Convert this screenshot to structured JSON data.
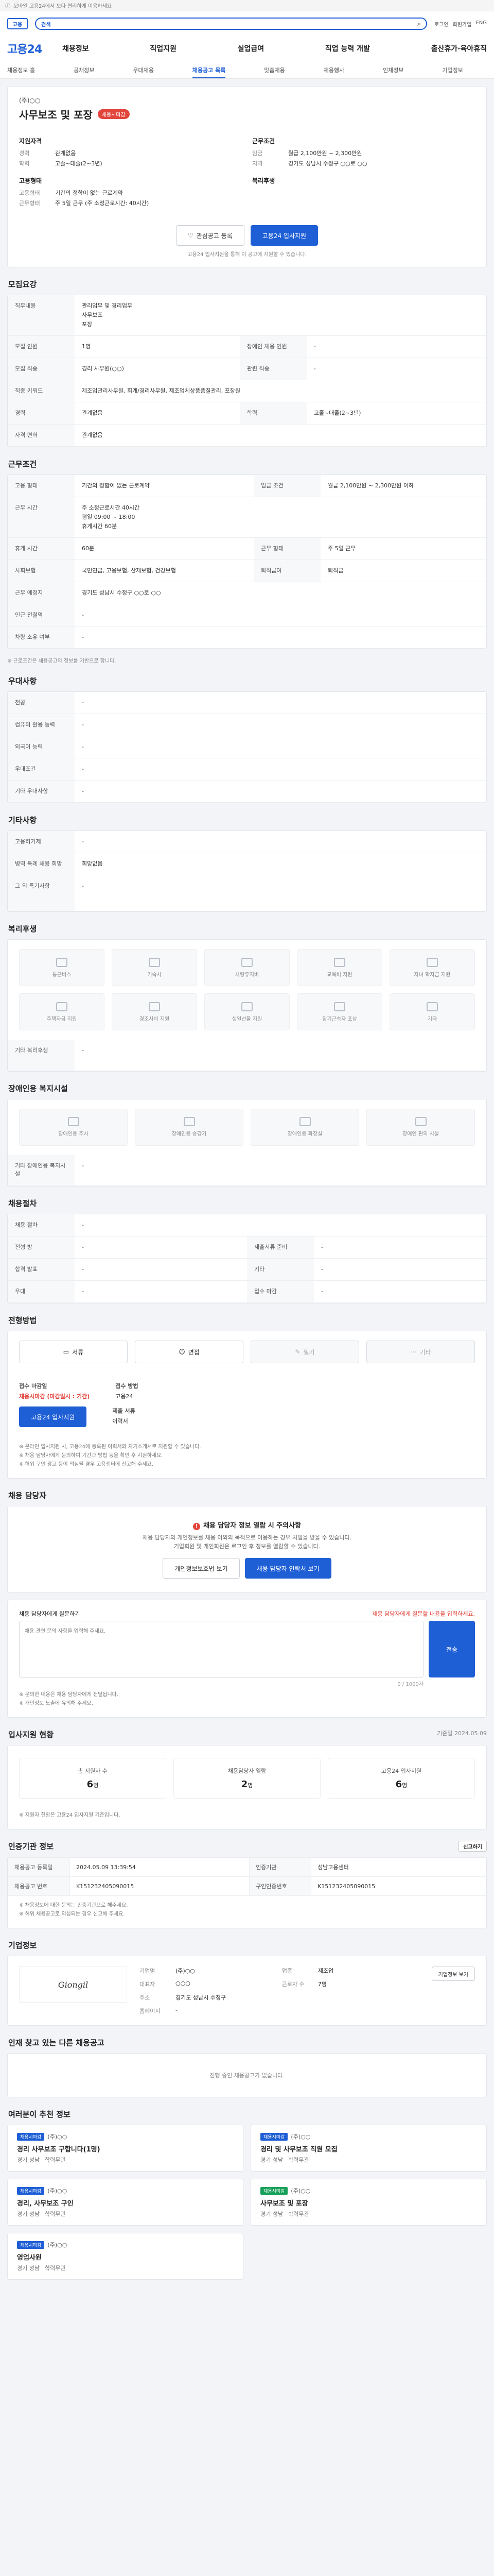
{
  "topbar": {
    "text": "모바일 고용24에서 보다 편리하게 이용하세요"
  },
  "header": {
    "mark": "고용",
    "search_tag": "검색",
    "search_placeholder": "",
    "links": [
      "로그인",
      "회원가입",
      "ENG"
    ],
    "logo": "고용24",
    "gnb": [
      "채용정보",
      "직업지원",
      "실업급여",
      "직업 능력 개발",
      "출산휴가·육아휴직"
    ],
    "subnav": [
      "채용정보 홈",
      "공채정보",
      "우대채용",
      "채용공고 목록",
      "맞춤채용",
      "채용행사",
      "인재정보",
      "기업정보"
    ],
    "subnav_active": "채용공고 목록"
  },
  "summary": {
    "company": "(주)○○",
    "title": "사무보조 및 포장",
    "deadline": "채용시마감",
    "left_heading": "지원자격",
    "left_rows": [
      {
        "k": "경력",
        "v": "관계없음"
      },
      {
        "k": "학력",
        "v": "고졸~대졸(2~3년)"
      }
    ],
    "left_heading2": "고용형태",
    "left_rows2": [
      {
        "k": "고용형태",
        "v": "기간의 정함이 없는 근로계약"
      },
      {
        "k": "근무형태",
        "v": "주 5일 근무 (주 소정근로시간: 40시간)"
      }
    ],
    "right_heading": "근무조건",
    "right_rows": [
      {
        "k": "임금",
        "v": "월급 2,100만원 ~ 2,300만원"
      },
      {
        "k": "지역",
        "v": "경기도 성남시 수정구 ○○로 ○○"
      }
    ],
    "right_heading2": "복리후생",
    "btn_scrap": "관심공고 등록",
    "btn_apply": "고용24 입사지원",
    "note": "고용24 입사지원을 통해 이 공고에 지원할 수 있습니다."
  },
  "sections": {
    "recruit": "모집요강",
    "conditions": "근무조건",
    "pref": "우대사항",
    "etc": "기타사항",
    "welfare": "복리후생",
    "disabled": "장애인용 복지시설",
    "process": "채용절차",
    "method": "전형방법",
    "manager": "채용 담당자",
    "stats": "입사지원 현황",
    "stats_sub": "기준일",
    "info": "인증기관 정보",
    "company": "기업정보",
    "other": "인재 찾고 있는 다른 채용공고",
    "rec": "여러분이 추천 정보"
  },
  "recruit_table": [
    {
      "k": "직무내용",
      "v": "관리업무 및 경리업무\n사무보조\n포장"
    },
    {
      "k": "모집 인원",
      "v": "1명",
      "k2": "장애인 채용 인원",
      "v2": "-"
    },
    {
      "k": "모집 직종",
      "v": "경리 사무원(○○)",
      "k2": "관련 직종",
      "v2": "-"
    },
    {
      "k": "직종 키워드",
      "v": "제조업관리사무원, 회계/경리사무원, 제조업체상품품질관리, 포장원"
    },
    {
      "k": "경력",
      "v": "관계없음",
      "k2": "학력",
      "v2": "고졸~대졸(2~3년)"
    },
    {
      "k": "자격 면허",
      "v": "관계없음"
    }
  ],
  "cond_table": [
    {
      "k": "고용 형태",
      "v": "기간의 정함이 없는 근로계약",
      "k2": "임금 조건",
      "v2": "월급 2,100만원 ~ 2,300만원 이하"
    },
    {
      "k": "근무 시간",
      "v": "주 소정근로시간 40시간\n평일 09:00 ~ 18:00\n휴게시간 60분"
    },
    {
      "k": "휴게 시간",
      "v": "60분",
      "k2": "근무 형태",
      "v2": "주 5일 근무"
    },
    {
      "k": "사회보험",
      "v": "국민연금, 고용보험, 산재보험, 건강보험",
      "k2": "퇴직급여",
      "v2": "퇴직금"
    },
    {
      "k": "근무 예정지",
      "v": "경기도 성남시 수정구 ○○로 ○○"
    },
    {
      "k": "인근 전철역",
      "v": "-"
    },
    {
      "k": "차량 소유 여부",
      "v": "-"
    }
  ],
  "cond_note": "※ 근로조건은 채용공고의 정보를 기반으로 합니다.",
  "pref_table": [
    {
      "k": "전공",
      "v": "-"
    },
    {
      "k": "컴퓨터 활용 능력",
      "v": "-"
    },
    {
      "k": "외국어 능력",
      "v": "-"
    },
    {
      "k": "우대조건",
      "v": "-"
    },
    {
      "k": "기타 우대사항",
      "v": "-"
    }
  ],
  "etc_table": [
    {
      "k": "고용허가제",
      "v": "-"
    },
    {
      "k": "병역 특례 채용 희망",
      "v": "희망없음"
    },
    {
      "k": "그 외 특기사항",
      "v": "-"
    }
  ],
  "welfare_items": [
    "통근버스",
    "기숙사",
    "차량유지비",
    "교육비 지원",
    "자녀 학자금 지원",
    "주택자금 지원",
    "경조사비 지원",
    "생일선물 지원",
    "장기근속자 포상",
    "기타"
  ],
  "welfare_etc_label": "기타 복리후생",
  "welfare_etc_value": "-",
  "disabled_items": [
    "장애인용 주차",
    "장애인용 승강기",
    "장애인용 화장실",
    "장애인 편의 시설"
  ],
  "disabled_etc_label": "기타 장애인용 복지시설",
  "disabled_etc_value": "-",
  "process_table": [
    {
      "k": "채용 절차",
      "v": "-"
    },
    {
      "k": "전형 방",
      "v": "-",
      "k2": "제출서류 준비",
      "v2": "-"
    },
    {
      "k": "합격 발표",
      "v": "-",
      "k2": "기타",
      "v2": "-"
    },
    {
      "k": "우대",
      "v": "-",
      "k2": "접수 마감",
      "v2": "-"
    }
  ],
  "methods": [
    {
      "label": "서류",
      "on": true
    },
    {
      "label": "면접",
      "on": true
    },
    {
      "label": "필기",
      "on": false
    },
    {
      "label": "기타",
      "on": false
    }
  ],
  "apply": {
    "deadline_lbl": "접수 마감일",
    "deadline_val": "채용시마감 (마감일시 : 기간)",
    "method_lbl": "접수 방법",
    "method_val": "고용24",
    "button": "고용24 입사지원",
    "docs_lbl": "제출 서류",
    "docs_val": "이력서"
  },
  "apply_notes": [
    "※ 온라인 입사지원 시, 고용24에 등록된 이력서와 자기소개서로 지원할 수 있습니다.",
    "※ 채용 담당자에게 문의하여 기간과 방법 등을 확인 후 지원하세요.",
    "※ 허위 구인 광고 등이 의심될 경우 고용센터에 신고해 주세요."
  ],
  "manager": {
    "alert": "채용 담당자 정보 열람 시 주의사항",
    "line1": "채용 담당자의 개인정보를 채용 이외의 목적으로 이용하는 경우 처벌을 받을 수 있습니다.",
    "line2": "기업회원 및 개인회원은 로그인 후 정보를 열람할 수 있습니다.",
    "btn1": "개인정보보호법 보기",
    "btn2": "채용 담당자 연락처 보기"
  },
  "qa": {
    "title": "채용 담당자에게 질문하기",
    "guide": "채용 담당자에게 질문할 내용을 입력하세요.",
    "placeholder": "채용 관련 문의 사항을 입력해 주세요.",
    "count": "0 / 1000자",
    "send": "전송",
    "notes": [
      "※ 문의한 내용은 채용 담당자에게 전달됩니다.",
      "※ 개인정보 노출에 유의해 주세요."
    ]
  },
  "stats": [
    {
      "t": "총 지원자 수",
      "n": "6",
      "u": "명"
    },
    {
      "t": "채용담당자 열람",
      "n": "2",
      "u": "명"
    },
    {
      "t": "고용24 입사지원",
      "n": "6",
      "u": "명"
    }
  ],
  "stats_note": "※ 지원자 현황은 고용24 입사지원 기준입니다.",
  "stats_date": "기준일 2024.05.09",
  "info_table": [
    {
      "k": "채용공고 등록일",
      "v": "2024.05.09 13:39:54",
      "k2": "인증기관",
      "v2": "성남고용센터"
    },
    {
      "k": "채용공고 번호",
      "v": "K151232405090015",
      "k2": "구인인증번호",
      "v2": "K151232405090015"
    }
  ],
  "info_notes": [
    "※ 채용정보에 대한 문의는 인증기관으로 해주세요.",
    "※ 허위 채용공고로 의심되는 경우 신고해 주세요."
  ],
  "info_btn": "신고하기",
  "company": {
    "logo": "Giongil",
    "rows": [
      {
        "k": "기업명",
        "v": "(주)○○",
        "k2": "업종",
        "v2": "제조업"
      },
      {
        "k": "대표자",
        "v": "○○○",
        "k2": "근로자 수",
        "v2": "7명"
      },
      {
        "k": "주소",
        "v": "경기도 성남시 수정구",
        "k2": "",
        "v2": ""
      },
      {
        "k": "홈페이지",
        "v": "-",
        "k2": "",
        "v2": ""
      }
    ],
    "btn": "기업정보 보기"
  },
  "other_empty": "진행 중인 채용공고가 없습니다.",
  "recs": [
    {
      "b": "채용시마감",
      "co": "(주)○○",
      "ti": "경리 사무보조 구합니다(1명)",
      "m1": "경기 성남",
      "m2": "학력무관"
    },
    {
      "b": "채용시마감",
      "co": "(주)○○",
      "ti": "경리 및 사무보조 직원 모집",
      "m1": "경기 성남",
      "m2": "학력무관"
    },
    {
      "b": "채용시마감",
      "co": "(주)○○",
      "ti": "경리, 사무보조 구인",
      "m1": "경기 성남",
      "m2": "학력무관"
    },
    {
      "b": "채용시마감",
      "co": "(주)○○",
      "ti": "사무보조 및 포장",
      "m1": "경기 성남",
      "m2": "학력무관"
    },
    {
      "b": "채용시마감",
      "co": "(주)○○",
      "ti": "영업사원",
      "m1": "경기 성남",
      "m2": "학력무관"
    }
  ]
}
